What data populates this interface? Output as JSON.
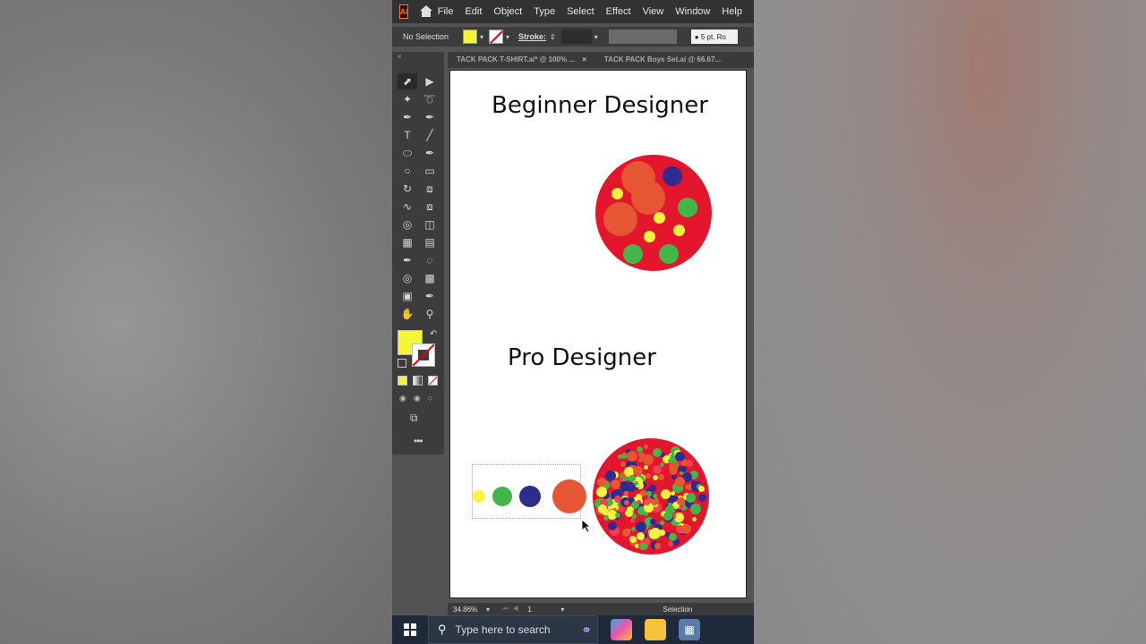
{
  "app": {
    "logo": "Ai",
    "menu": [
      "File",
      "Edit",
      "Object",
      "Type",
      "Select",
      "Effect",
      "View",
      "Window",
      "Help"
    ]
  },
  "control": {
    "selection": "No Selection",
    "stroke_label": "Stroke:",
    "brush": "5 pt. Ro",
    "fill_color": "#f5f538"
  },
  "tabs": [
    {
      "label": "TACK PACK T-SHIRT.ai* @ 100% ...",
      "close": "×"
    },
    {
      "label": "TACK PACK Boys Set.ai @ 66.67..."
    }
  ],
  "tools": {
    "grip": "«",
    "icons": [
      "selection-tool",
      "direct-selection-tool",
      "magic-wand-tool",
      "lasso-tool",
      "pen-tool",
      "curvature-tool",
      "type-tool",
      "line-segment-tool",
      "ellipse-tool",
      "paintbrush-tool",
      "shaper-tool",
      "eraser-tool",
      "rotate-tool",
      "scale-tool",
      "warp-tool",
      "free-transform-tool",
      "shape-builder-tool",
      "perspective-grid-tool",
      "mesh-tool",
      "gradient-tool",
      "eyedropper-tool",
      "blend-tool",
      "symbol-sprayer-tool",
      "column-graph-tool",
      "artboard-tool",
      "slice-tool",
      "hand-tool",
      "zoom-tool"
    ]
  },
  "artboard": {
    "heading_beginner": "Beginner Designer",
    "heading_pro": "Pro  Designer",
    "colors": {
      "red": "#e3162d",
      "orange": "#e75633",
      "yellow": "#f7f33e",
      "green": "#43b649",
      "navy": "#2e2d8f"
    }
  },
  "status": {
    "zoom": "34.86%",
    "artboard_num": "1",
    "tool": "Selection"
  },
  "taskbar": {
    "search_placeholder": "Type here to search"
  }
}
